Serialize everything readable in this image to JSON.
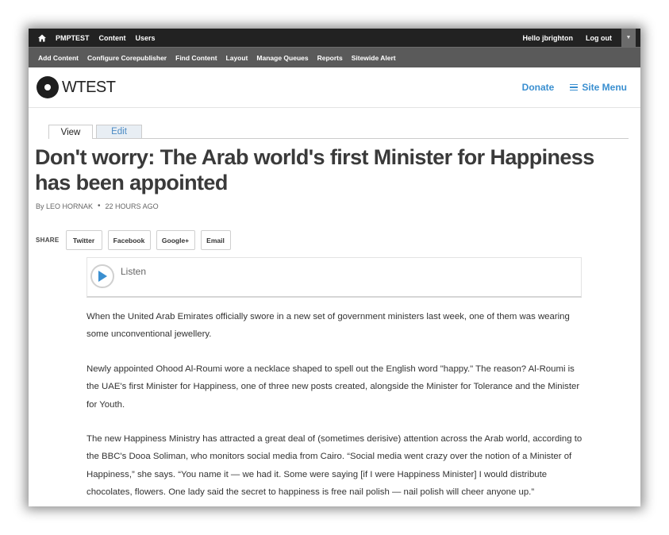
{
  "toolbar": {
    "site": "PMPTEST",
    "content": "Content",
    "users": "Users",
    "hello": "Hello jbrighton",
    "logout": "Log out"
  },
  "admin_menu": [
    "Add Content",
    "Configure Corepublisher",
    "Find Content",
    "Layout",
    "Manage Queues",
    "Reports",
    "Sitewide Alert"
  ],
  "header": {
    "logo_text": "WTEST",
    "donate": "Donate",
    "site_menu": "Site Menu"
  },
  "tabs": {
    "view": "View",
    "edit": "Edit"
  },
  "article": {
    "title_line1": "Don't worry: The Arab world's first Minister for Happiness",
    "title_line2": "has been appointed",
    "author": "By LEO HORNAK",
    "time": "22 HOURS AGO",
    "share_label": "SHARE",
    "share_buttons": [
      "Twitter",
      "Facebook",
      "Google+",
      "Email"
    ],
    "listen": "Listen",
    "paragraphs": [
      "When the United Arab Emirates officially swore in a new set of government ministers last week, one of them was wearing some unconventional jewellery.",
      "Newly appointed Ohood Al-Roumi wore a necklace shaped to spell out the English word \"happy.\" The reason? Al-Roumi is the UAE's first Minister for Happiness, one of three new posts created, alongside the Minister for Tolerance and the Minister for Youth.",
      "The new Happiness Ministry has attracted a great deal of (sometimes derisive) attention across the Arab world, according to the BBC's Dooa Soliman, who monitors social media from Cairo. “Social media went crazy over the notion of a Minister of Happiness,” she says. “You name it — we had it. Some were saying [if I were Happiness Minister] I would distribute chocolates, flowers. One lady said the secret to happiness is free nail polish — nail polish will cheer anyone up.”"
    ]
  },
  "colors": {
    "accent": "#3a8fd0",
    "toolbar": "#222222",
    "toolbar2": "#5a5a5a"
  }
}
